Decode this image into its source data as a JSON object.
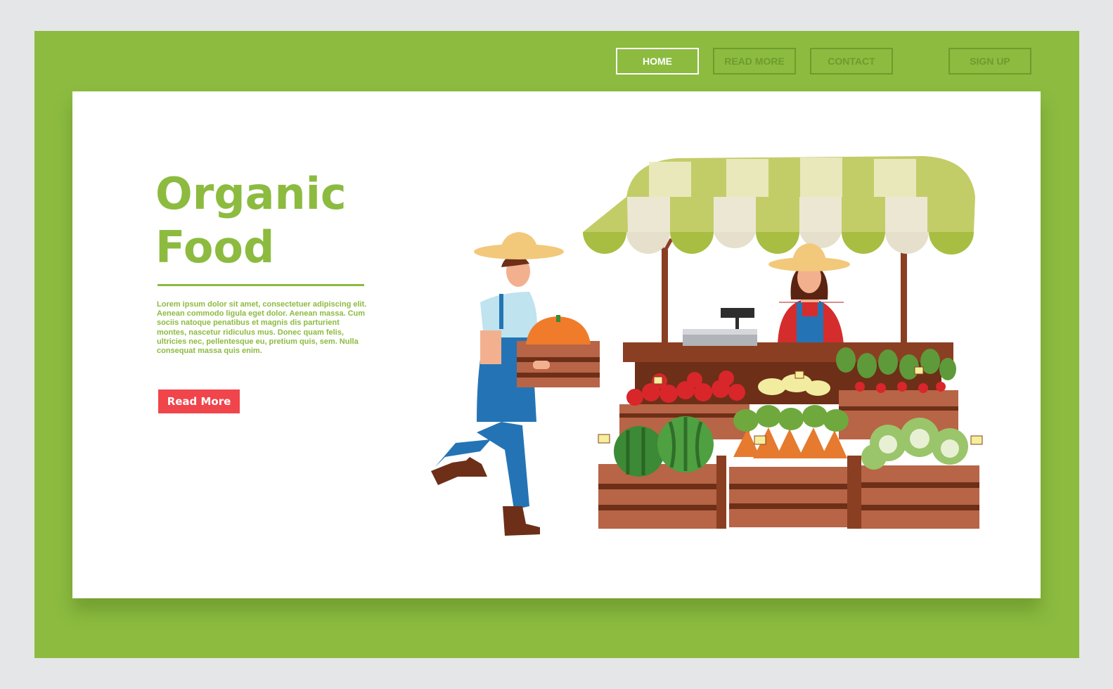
{
  "nav": {
    "items": [
      {
        "label": "HOME",
        "active": true
      },
      {
        "label": "READ MORE",
        "active": false
      },
      {
        "label": "CONTACT",
        "active": false
      }
    ],
    "signup_label": "SIGN UP"
  },
  "hero": {
    "title": "Organic\nFood",
    "body": "Lorem ipsum dolor sit amet, consectetuer adipiscing elit. Aenean commodo ligula eget dolor. Aenean massa. Cum sociis natoque penatibus et magnis dis parturient montes, nascetur ridiculus mus. Donec quam felis, ultricies nec, pellentesque eu, pretium quis, sem. Nulla consequat massa quis enim.",
    "cta_label": "Read More"
  },
  "illustration": {
    "subject": "farmers-market-stall"
  },
  "colors": {
    "brand_green": "#8cbb40",
    "nav_inactive": "#6e9c2c",
    "cta_red": "#f0454b",
    "background": "#e5e6e8"
  }
}
